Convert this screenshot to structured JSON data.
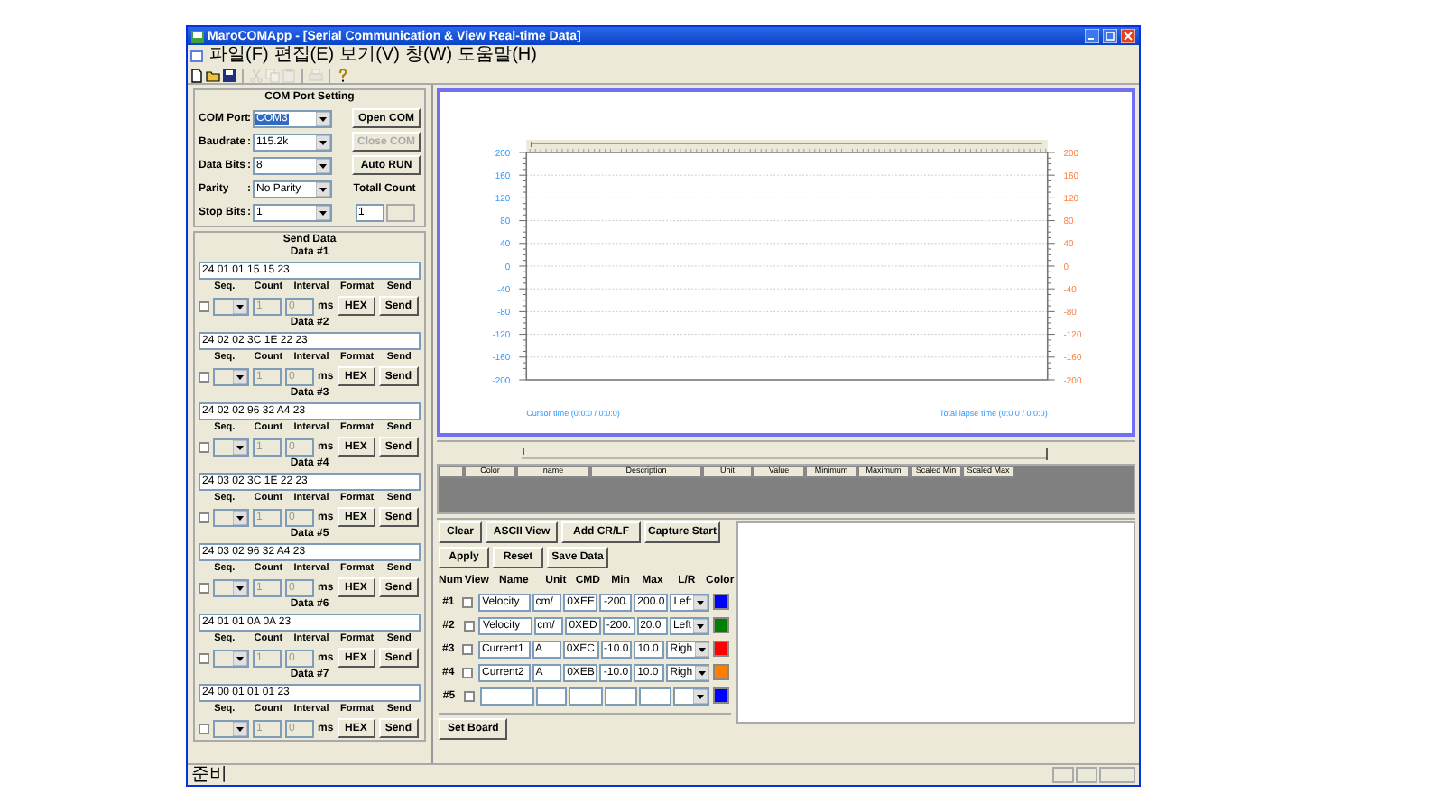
{
  "window": {
    "title": "MaroCOMApp - [Serial Communication & View Real-time Data]"
  },
  "menu": [
    "파일(F)",
    "편집(E)",
    "보기(V)",
    "창(W)",
    "도움말(H)"
  ],
  "toolbar": [
    {
      "kind": "new",
      "disabled": false
    },
    {
      "kind": "open",
      "disabled": false
    },
    {
      "kind": "save",
      "disabled": false
    },
    {
      "kind": "sep"
    },
    {
      "kind": "cut",
      "disabled": true
    },
    {
      "kind": "copy",
      "disabled": true
    },
    {
      "kind": "paste",
      "disabled": true
    },
    {
      "kind": "sep"
    },
    {
      "kind": "print",
      "disabled": true
    },
    {
      "kind": "sep"
    },
    {
      "kind": "about",
      "disabled": false
    }
  ],
  "com_port_setting": {
    "title": "COM Port Setting",
    "rows": [
      {
        "label": "COM Port",
        "colon": ":",
        "value": "COM3",
        "highlighted": true,
        "button": {
          "label": "Open COM",
          "disabled": false
        }
      },
      {
        "label": "Baudrate",
        "colon": ":",
        "value": "115.2k",
        "highlighted": false,
        "button": {
          "label": "Close COM",
          "disabled": true
        }
      },
      {
        "label": "Data Bits",
        "colon": ":",
        "value": "8",
        "highlighted": false,
        "button": {
          "label": "Auto RUN",
          "disabled": false
        }
      },
      {
        "label": "Parity",
        "colon": ":",
        "value": "No Parity",
        "highlighted": false
      },
      {
        "label": "Stop Bits",
        "colon": ":",
        "value": "1",
        "highlighted": false
      }
    ],
    "total_count": {
      "label": "Totall Count",
      "value": "1"
    }
  },
  "send_data": {
    "title": "Send Data",
    "items": [
      {
        "title": "Data #1",
        "hex": "24 01 01 15 15 23",
        "labels": [
          "Seq.",
          "Count",
          "Interval",
          "Format",
          "Send"
        ],
        "checked": false,
        "count": "1",
        "interval": "0",
        "unit": "ms",
        "format": "HEX",
        "send": "Send"
      },
      {
        "title": "Data #2",
        "hex": "24 02 02 3C 1E 22 23",
        "labels": [
          "Seq.",
          "Count",
          "Interval",
          "Format",
          "Send"
        ],
        "checked": false,
        "count": "1",
        "interval": "0",
        "unit": "ms",
        "format": "HEX",
        "send": "Send"
      },
      {
        "title": "Data #3",
        "hex": "24 02 02 96 32 A4 23",
        "labels": [
          "Seq.",
          "Count",
          "Interval",
          "Format",
          "Send"
        ],
        "checked": false,
        "count": "1",
        "interval": "0",
        "unit": "ms",
        "format": "HEX",
        "send": "Send"
      },
      {
        "title": "Data #4",
        "hex": "24 03 02 3C 1E 22 23",
        "labels": [
          "Seq.",
          "Count",
          "Interval",
          "Format",
          "Send"
        ],
        "checked": false,
        "count": "1",
        "interval": "0",
        "unit": "ms",
        "format": "HEX",
        "send": "Send"
      },
      {
        "title": "Data #5",
        "hex": "24 03 02 96 32 A4 23",
        "labels": [
          "Seq.",
          "Count",
          "Interval",
          "Format",
          "Send"
        ],
        "checked": false,
        "count": "1",
        "interval": "0",
        "unit": "ms",
        "format": "HEX",
        "send": "Send"
      },
      {
        "title": "Data #6",
        "hex": "24 01 01 0A 0A 23",
        "labels": [
          "Seq.",
          "Count",
          "Interval",
          "Format",
          "Send"
        ],
        "checked": false,
        "count": "1",
        "interval": "0",
        "unit": "ms",
        "format": "HEX",
        "send": "Send"
      },
      {
        "title": "Data #7",
        "hex": "24 00 01 01 01 23",
        "labels": [
          "Seq.",
          "Count",
          "Interval",
          "Format",
          "Send"
        ],
        "checked": false,
        "count": "1",
        "interval": "0",
        "unit": "ms",
        "format": "HEX",
        "send": "Send"
      }
    ]
  },
  "chart": {
    "left_axis_ticks": [
      "200",
      "160",
      "120",
      "80",
      "40",
      "0",
      "-40",
      "-80",
      "-120",
      "-160",
      "-200"
    ],
    "right_axis_ticks": [
      "200",
      "160",
      "120",
      "80",
      "40",
      "0",
      "-40",
      "-80",
      "-120",
      "-160",
      "-200"
    ],
    "cursor_time": "Cursor time (0:0:0 / 0:0:0)",
    "total_lapse_time": "Total lapse time (0:0:0 / 0:0:0)"
  },
  "grid": {
    "columns": [
      "Color",
      "name",
      "Description",
      "Unit",
      "Value",
      "Minimum",
      "Maximum",
      "Scaled Min",
      "Scaled Max"
    ]
  },
  "buttons_row_1": [
    "Clear",
    "ASCII View",
    "Add CR/LF",
    "Capture Start"
  ],
  "buttons_row_2": [
    "Apply",
    "Reset",
    "Save Data"
  ],
  "channels": {
    "columns": [
      "Num",
      "View",
      "Name",
      "Unit",
      "CMD",
      "Min",
      "Max",
      "L/R",
      "Color"
    ],
    "rows": [
      {
        "num": "#1",
        "view": false,
        "name": "Velocity",
        "unit": "cm/",
        "cmd": "0XEE",
        "min": "-200.",
        "max": "200.0",
        "lr": "Left",
        "color": "#0000ff"
      },
      {
        "num": "#2",
        "view": false,
        "name": "Velocity",
        "unit": "cm/",
        "cmd": "0XED",
        "min": "-200.",
        "max": "20.0",
        "lr": "Left",
        "color": "#008000"
      },
      {
        "num": "#3",
        "view": false,
        "name": "Current1",
        "unit": "A",
        "cmd": "0XEC",
        "min": "-10.0",
        "max": "10.0",
        "lr": "Righ",
        "color": "#ff0000"
      },
      {
        "num": "#4",
        "view": false,
        "name": "Current2",
        "unit": "A",
        "cmd": "0XEB",
        "min": "-10.0",
        "max": "10.0",
        "lr": "Righ",
        "color": "#ff8000"
      },
      {
        "num": "#5",
        "view": false,
        "name": "",
        "unit": "",
        "cmd": "",
        "min": "",
        "max": "",
        "lr": "",
        "color": "#0000ff"
      }
    ]
  },
  "set_board": "Set Board",
  "status_bar": "준비"
}
